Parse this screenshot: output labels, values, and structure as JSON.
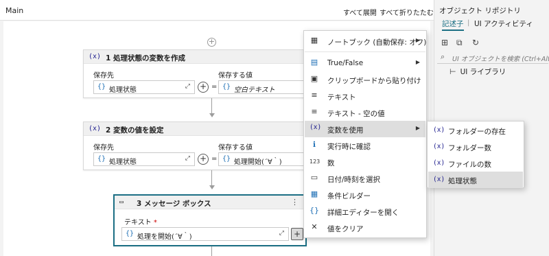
{
  "designer": {
    "title": "Main",
    "expand_all": "すべて展開",
    "collapse_all": "すべて折りたたむ"
  },
  "activities": [
    {
      "icon": "(x)",
      "title": "1 処理状態の変数を作成",
      "target_label": "保存先",
      "value_label": "保存する値",
      "target_value": "処理状態",
      "value_value": "空白テキスト"
    },
    {
      "icon": "(x)",
      "title": "2 変数の値を設定",
      "target_label": "保存先",
      "value_label": "保存する値",
      "target_value": "処理状態",
      "value_value": "処理開始(´∀｀)"
    },
    {
      "icon": "▭",
      "title": "3 メッセージ ボックス",
      "text_label": "テキスト",
      "required_mark": "*",
      "text_value": "処理を開始(´∀｀)"
    }
  ],
  "right_pane": {
    "title": "オブジェクト リポジトリ",
    "tabs": [
      "記述子",
      "UI アクティビティ"
    ],
    "search_placeholder": "UI オブジェクトを検索 (Ctrl+Alt+O)",
    "library_label": "UI ライブラリ"
  },
  "context_menu": {
    "items": [
      {
        "icon": "▦",
        "label": "ノートブック (自動保存: オフ)",
        "submenu": true
      },
      {
        "icon": "▤",
        "label": "True/False",
        "submenu": true
      },
      {
        "icon": "▣",
        "label": "クリップボードから貼り付け",
        "submenu": false
      },
      {
        "icon": "≡",
        "label": "テキスト",
        "submenu": false
      },
      {
        "icon": "≡",
        "label": "テキスト - 空の値",
        "submenu": false
      },
      {
        "icon": "(x)",
        "label": "変数を使用",
        "submenu": true
      },
      {
        "icon": "ℹ",
        "label": "実行時に確認",
        "submenu": false
      },
      {
        "icon": "123",
        "label": "数",
        "submenu": false
      },
      {
        "icon": "▭",
        "label": "日付/時刻を選択",
        "submenu": false
      },
      {
        "icon": "▦",
        "label": "条件ビルダー",
        "submenu": false
      },
      {
        "icon": "{}",
        "label": "詳細エディターを開く",
        "submenu": false
      },
      {
        "icon": "✕",
        "label": "値をクリア",
        "submenu": false
      }
    ],
    "highlighted_index": 5
  },
  "sub_menu": {
    "items": [
      {
        "icon": "(x)",
        "label": "フォルダーの存在"
      },
      {
        "icon": "(x)",
        "label": "フォルダー数"
      },
      {
        "icon": "(x)",
        "label": "ファイルの数"
      },
      {
        "icon": "(x)",
        "label": "処理状態"
      }
    ],
    "highlighted_index": 3
  }
}
